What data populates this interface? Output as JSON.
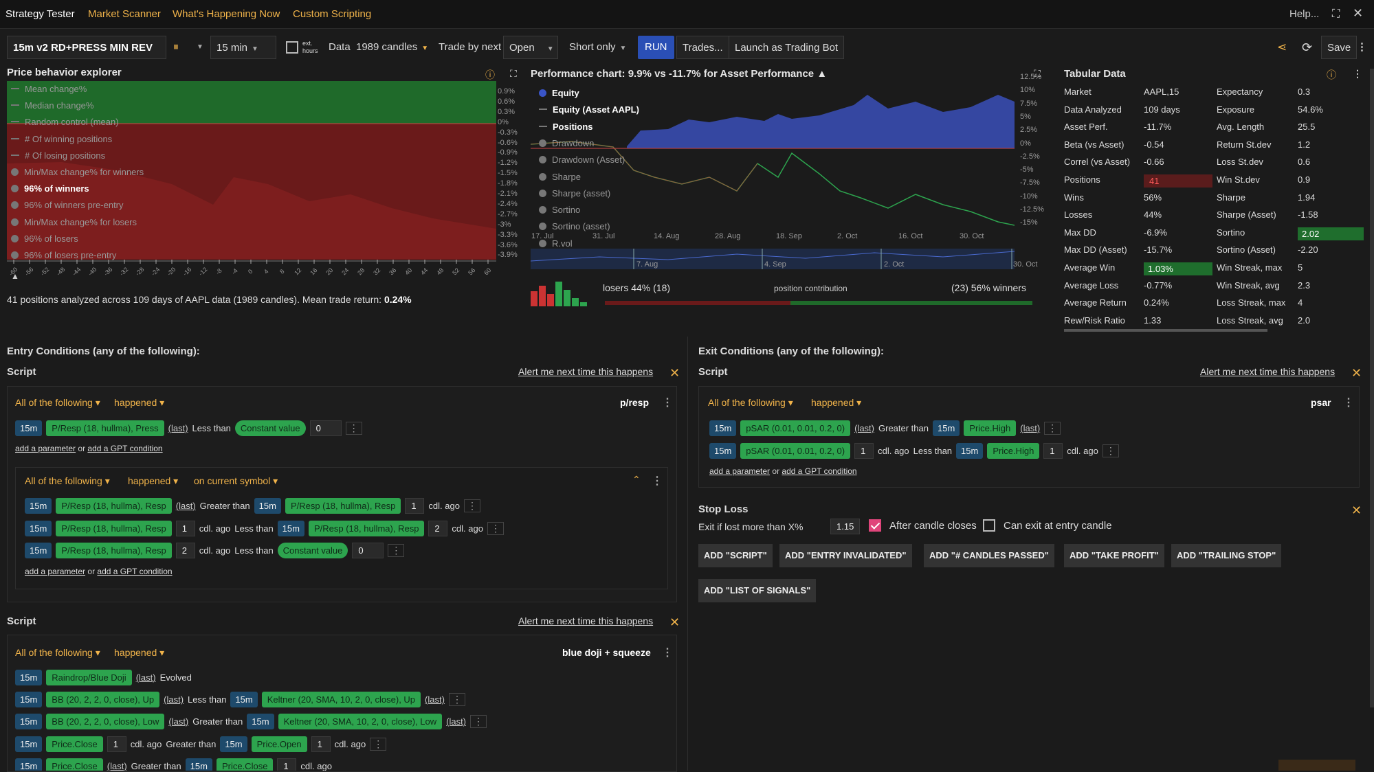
{
  "tabs": [
    "Strategy Tester",
    "Market Scanner",
    "What's Happening Now",
    "Custom Scripting"
  ],
  "help_label": "Help...",
  "toolbar": {
    "strategy_name": "15m v2 RD+PRESS MIN REV",
    "interval": "15 min",
    "ext_hours": "ext. hours",
    "data_label": "Data",
    "candles": "1989 candles",
    "trade_by_label": "Trade by next",
    "trade_by": "Open",
    "direction": "Short only",
    "run": "RUN",
    "trades": "Trades...",
    "launch": "Launch as Trading Bot",
    "save": "Save"
  },
  "pbe": {
    "title": "Price behavior explorer",
    "legend": [
      "Mean change%",
      "Median change%",
      "Random control (mean)",
      "# Of winning positions",
      "# Of losing positions",
      "Min/Max change% for winners",
      "96% of winners",
      "96% of winners pre-entry",
      "Min/Max change% for losers",
      "96% of losers",
      "96% of losers pre-entry"
    ],
    "y_ticks": [
      "0.9%",
      "0.6%",
      "0.3%",
      "0%",
      "-0.3%",
      "-0.6%",
      "-0.9%",
      "-1.2%",
      "-1.5%",
      "-1.8%",
      "-2.1%",
      "-2.4%",
      "-2.7%",
      "-3%",
      "-3.3%",
      "-3.6%",
      "-3.9%"
    ],
    "x_ticks": [
      "-60",
      "-56",
      "-52",
      "-48",
      "-44",
      "-40",
      "-36",
      "-32",
      "-28",
      "-24",
      "-20",
      "-16",
      "-12",
      "-8",
      "-4",
      "0",
      "4",
      "8",
      "12",
      "16",
      "20",
      "24",
      "28",
      "32",
      "36",
      "40",
      "44",
      "48",
      "52",
      "56",
      "60"
    ],
    "summary": "41 positions analyzed across 109 days of AAPL data (1989 candles). Mean trade return: ",
    "summary_bold": "0.24%"
  },
  "perf": {
    "title": "Performance chart: 9.9% vs -11.7% for Asset Performance",
    "legend": [
      "Equity",
      "Equity (Asset AAPL)",
      "Positions",
      "Drawdown",
      "Drawdown (Asset)",
      "Sharpe",
      "Sharpe (asset)",
      "Sortino",
      "Sortino (asset)",
      "R.vol"
    ],
    "y_ticks": [
      "12.5%",
      "10%",
      "7.5%",
      "5%",
      "2.5%",
      "0%",
      "-2.5%",
      "-5%",
      "-7.5%",
      "-10%",
      "-12.5%",
      "-15%"
    ],
    "x_ticks": [
      "17. Jul",
      "31. Jul",
      "14. Aug",
      "28. Aug",
      "18. Sep",
      "2. Oct",
      "16. Oct",
      "30. Oct"
    ],
    "nav_ticks": [
      "7. Aug",
      "4. Sep",
      "2. Oct",
      "30. Oct"
    ],
    "losers": "losers 44% (18)",
    "contribution": "position contribution",
    "winners": "(23) 56% winners"
  },
  "tabular": {
    "title": "Tabular Data",
    "left": [
      [
        "Market",
        "AAPL,15"
      ],
      [
        "Data Analyzed",
        "109 days"
      ],
      [
        "Asset Perf.",
        "-11.7%"
      ],
      [
        "Beta (vs Asset)",
        "-0.54"
      ],
      [
        "Correl (vs Asset)",
        "-0.66"
      ],
      [
        "Positions",
        "41"
      ],
      [
        "Wins",
        "56%"
      ],
      [
        "Losses",
        "44%"
      ],
      [
        "Max DD",
        "-6.9%"
      ],
      [
        "Max DD (Asset)",
        "-15.7%"
      ],
      [
        "Average Win",
        "1.03%"
      ],
      [
        "Average Loss",
        "-0.77%"
      ],
      [
        "Average Return",
        "0.24%"
      ],
      [
        "Rew/Risk Ratio",
        "1.33"
      ]
    ],
    "right": [
      [
        "Expectancy",
        "0.3"
      ],
      [
        "Exposure",
        "54.6%"
      ],
      [
        "Avg. Length",
        "25.5"
      ],
      [
        "Return St.dev",
        "1.2"
      ],
      [
        "Loss St.dev",
        "0.6"
      ],
      [
        "Win St.dev",
        "0.9"
      ],
      [
        "Sharpe",
        "1.94"
      ],
      [
        "Sharpe (Asset)",
        "-1.58"
      ],
      [
        "Sortino",
        "2.02"
      ],
      [
        "Sortino (Asset)",
        "-2.20"
      ],
      [
        "Win Streak, max",
        "5"
      ],
      [
        "Win Streak, avg",
        "2.3"
      ],
      [
        "Loss Streak, max",
        "4"
      ],
      [
        "Loss Streak, avg",
        "2.0"
      ]
    ]
  },
  "entry": {
    "title": "Entry Conditions (any of the following):",
    "script_label": "Script",
    "alert": "Alert me next time this happens",
    "all_following": "All of the following",
    "happened": "happened",
    "on_current": "on current symbol",
    "name1": "p/resp",
    "name2": "blue doji + squeeze",
    "add_param": "add a parameter",
    "or": "or",
    "add_gpt": "add a GPT condition",
    "tf": "15m",
    "last": "(last)",
    "cdl_ago": "cdl. ago",
    "less_than": "Less than",
    "greater_than": "Greater than",
    "evolved": "Evolved",
    "const": "Constant value",
    "pr_press": "P/Resp (18, hullma), Press",
    "pr_resp": "P/Resp (18, hullma), Resp",
    "raindrop": "Raindrop/Blue Doji",
    "bb_up": "BB (20, 2, 2, 0, close), Up",
    "bb_low": "BB (20, 2, 2, 0, close), Low",
    "kelt_up": "Keltner (20, SMA, 10, 2, 0, close), Up",
    "kelt_low": "Keltner (20, SMA, 10, 2, 0, close), Low",
    "price_close": "Price.Close",
    "price_open": "Price.Open",
    "v0": "0",
    "v1": "1",
    "v2": "2"
  },
  "exit": {
    "title": "Exit Conditions (any of the following):",
    "name": "psar",
    "psar": "pSAR (0.01, 0.01, 0.2, 0)",
    "price_high": "Price.High",
    "stop_title": "Stop Loss",
    "stop_label": "Exit if lost more than X%",
    "stop_value": "1.15",
    "after_close": "After candle closes",
    "entry_candle": "Can exit at entry candle",
    "buttons": [
      "ADD \"SCRIPT\"",
      "ADD \"ENTRY INVALIDATED\"",
      "ADD \"# CANDLES PASSED\"",
      "ADD \"TAKE PROFIT\"",
      "ADD \"TRAILING STOP\"",
      "ADD \"LIST OF SIGNALS\""
    ]
  },
  "colors": {
    "accent": "#f0b34a",
    "run": "#2a4fb5",
    "green": "#2da44e",
    "red": "#e04040",
    "equity": "#3a55c8"
  }
}
